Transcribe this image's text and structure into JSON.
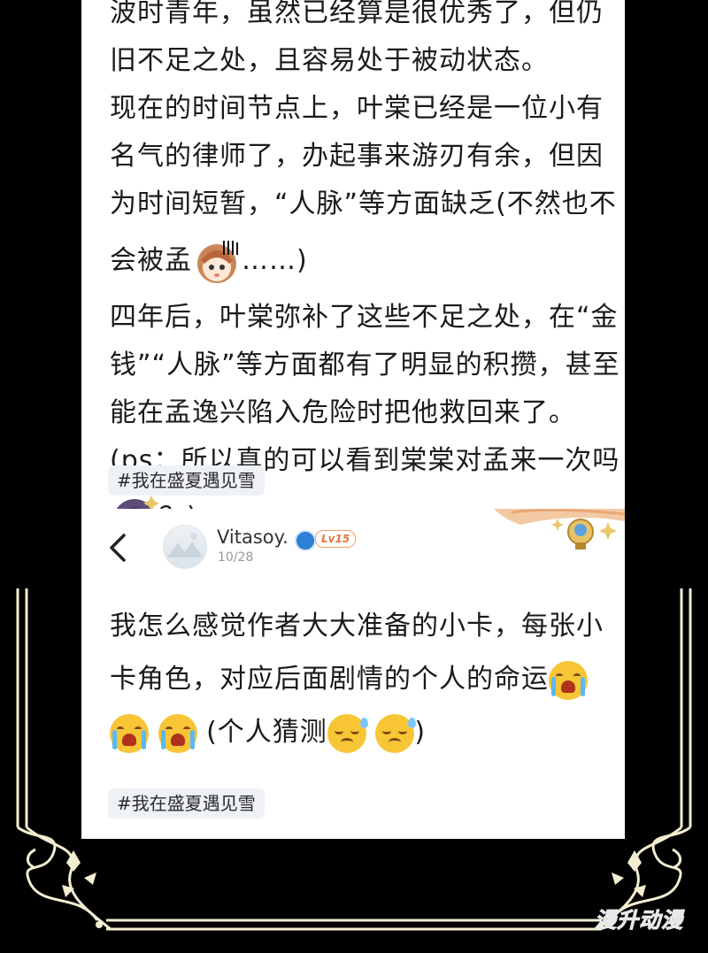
{
  "top_post": {
    "lines": [
      "波时青年，虽然已经算是很优秀了，但仍",
      "旧不足之处，且容易处于被动状态。",
      "现在的时间节点上，叶棠已经是一位小有",
      "名气的律师了，办起事来游刃有余，但因",
      "为时间短暂，“人脉”等方面缺乏(不然也不",
      "会被孟",
      "……)",
      "四年后，叶棠弥补了这些不足之处，在“金",
      "钱”“人脉”等方面都有了明显的积攒，甚至",
      "能在孟逸兴陷入危险时把他救回来了。",
      "(ps：所以真的可以看到棠棠对孟来一次吗",
      "？)"
    ],
    "tag": "#我在盛夏遇见雪"
  },
  "comment": {
    "back_icon": "chevron-left-icon",
    "username": "Vitasoy.",
    "level": "Lv15",
    "date": "10/28",
    "lines": [
      "我怎么感觉作者大大准备的小卡，每张小",
      "卡角色，对应后面剧情的个人的命运",
      "(个人猜测",
      ")"
    ],
    "tag": "#我在盛夏遇见雪"
  },
  "watermark": "漫升动漫",
  "colors": {
    "background": "#000000",
    "card": "#ffffff",
    "frame": "#f3edd2",
    "level": "#e8753a",
    "tag_bg": "#eef1f5"
  }
}
